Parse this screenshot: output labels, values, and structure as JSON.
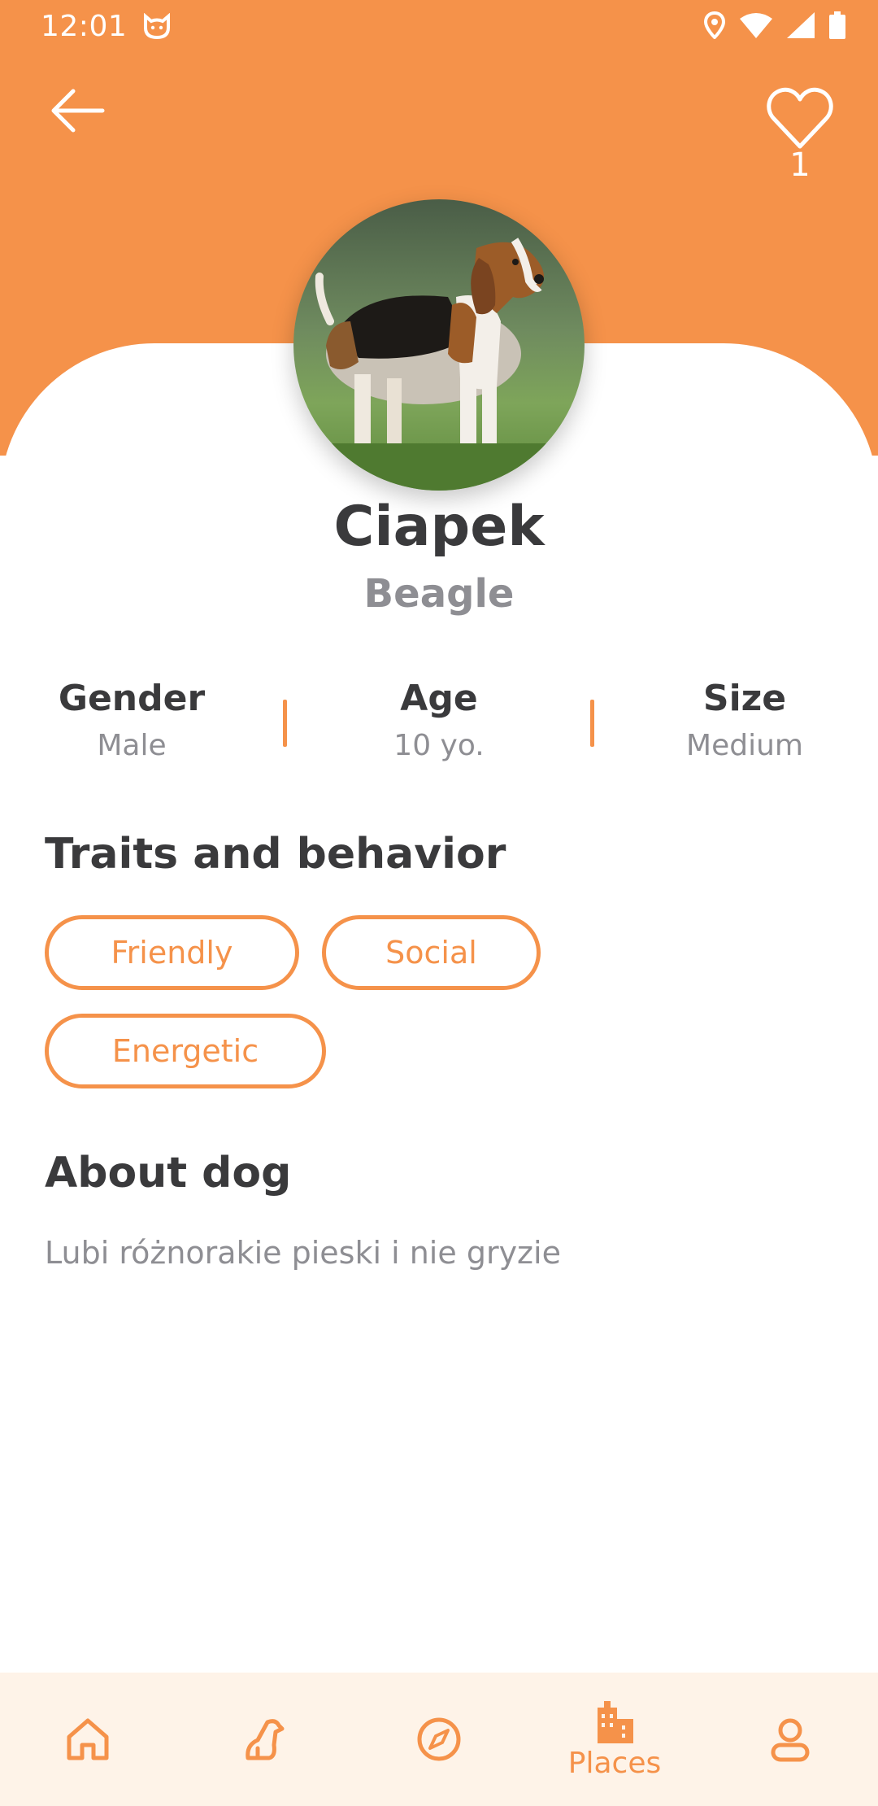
{
  "status_bar": {
    "time": "12:01"
  },
  "header": {
    "favorite_count": "1"
  },
  "profile": {
    "name": "Ciapek",
    "breed": "Beagle"
  },
  "stats": [
    {
      "label": "Gender",
      "value": "Male"
    },
    {
      "label": "Age",
      "value": "10 yo."
    },
    {
      "label": "Size",
      "value": "Medium"
    }
  ],
  "traits": {
    "title": "Traits and behavior",
    "items": [
      "Friendly",
      "Social",
      "Energetic"
    ]
  },
  "about": {
    "title": "About dog",
    "text": "Lubi różnorakie pieski i nie gryzie"
  },
  "bottom_nav": {
    "active": "places",
    "items": [
      {
        "icon": "home-icon",
        "label": ""
      },
      {
        "icon": "dog-icon",
        "label": ""
      },
      {
        "icon": "compass-icon",
        "label": ""
      },
      {
        "icon": "buildings-icon",
        "label": "Places"
      },
      {
        "icon": "user-icon",
        "label": ""
      }
    ]
  },
  "colors": {
    "accent": "#F5924A",
    "nav_background": "#FEF3E8",
    "text_dark": "#3A3A3C",
    "text_muted": "#8E8E93"
  }
}
